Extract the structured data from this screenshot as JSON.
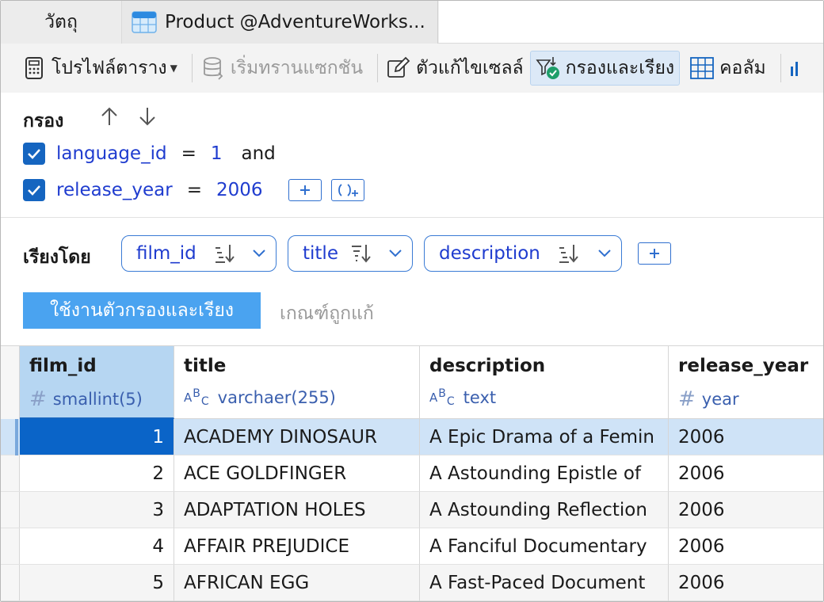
{
  "tabs": [
    {
      "label": "วัตถุ"
    },
    {
      "label": "Product @AdventureWorks..."
    }
  ],
  "toolbar": {
    "table_profile": "โปรไฟล์ตาราง",
    "begin_transaction": "เริ่มทรานแซกชัน",
    "cell_editor": "ตัวแก้ไขเซลล์",
    "filter_sort": "กรองและเรียง",
    "columns": "คอลัม"
  },
  "filter": {
    "title": "กรอง",
    "rows": [
      {
        "column": "language_id",
        "op": "=",
        "value": "1",
        "conj": "and"
      },
      {
        "column": "release_year",
        "op": "=",
        "value": "2006"
      }
    ]
  },
  "sort": {
    "title": "เรียงโดย",
    "chips": [
      {
        "label": "film_id"
      },
      {
        "label": "title"
      },
      {
        "label": "description"
      }
    ],
    "apply_label": "ใช้งานตัวกรองและเรียง",
    "fix_label": "เกณฑ์ถูกแก้"
  },
  "grid": {
    "columns": [
      {
        "name": "film_id",
        "type": "smallint(5)",
        "kind": "numeric"
      },
      {
        "name": "title",
        "type": "varchaer(255)",
        "kind": "text"
      },
      {
        "name": "description",
        "type": "text",
        "kind": "text"
      },
      {
        "name": "release_year",
        "type": "year",
        "kind": "numeric"
      }
    ],
    "rows": [
      [
        "1",
        "ACADEMY DINOSAUR",
        "A Epic Drama of a Femin",
        "2006"
      ],
      [
        "2",
        "ACE GOLDFINGER",
        "A Astounding Epistle of",
        "2006"
      ],
      [
        "3",
        "ADAPTATION HOLES",
        "A Astounding Reflection",
        "2006"
      ],
      [
        "4",
        "AFFAIR PREJUDICE",
        "A Fanciful Documentary",
        "2006"
      ],
      [
        "5",
        "AFRICAN EGG",
        "A Fast-Paced Document",
        "2006"
      ]
    ]
  },
  "colors": {
    "accent": "#1565c0",
    "selected_header": "#b6d6f2",
    "apply_button": "#4aa3f0",
    "link_blue": "#1f3ccf"
  }
}
